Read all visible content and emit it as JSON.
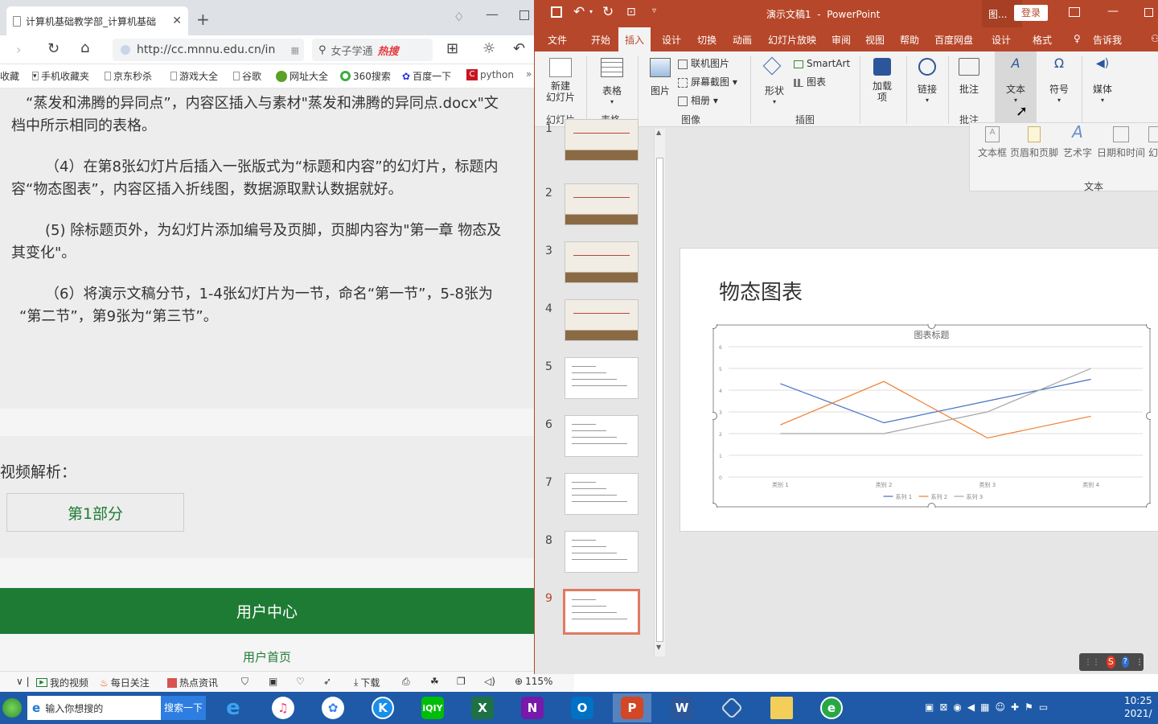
{
  "browser": {
    "tab_title": "计算机基础教学部_计算机基础",
    "url": "http://cc.mnnu.edu.cn/in",
    "search_text": "女子学通",
    "search_hot": "热搜",
    "favorites": [
      "收藏",
      "手机收藏夹",
      "京东秒杀",
      "游戏大全",
      "谷歌",
      "网址大全",
      "360搜索",
      "百度一下",
      "python"
    ],
    "paragraphs": [
      "“蒸发和沸腾的异同点”，内容区插入与素材\"蒸发和沸腾的异同点.docx\"文",
      "档中所示相同的表格。",
      "（4）在第8张幻灯片后插入一张版式为“标题和内容”的幻灯片，标题内",
      "容“物态图表”，内容区插入折线图，数据源取默认数据就好。",
      "(5) 除标题页外，为幻灯片添加编号及页脚，页脚内容为\"第一章  物态及",
      "其变化\"。",
      "（6）将演示文稿分节，1-4张幻灯片为一节，命名“第一节”，5-8张为",
      "“第二节”，第9张为“第三节”。"
    ],
    "video_label": "视频解析：",
    "part_button": "第1部分",
    "user_center": "用户中心",
    "user_home": "用户首页",
    "status_items": [
      "我的视频",
      "每日关注",
      "热点资讯",
      "下载",
      "115%"
    ]
  },
  "ppt": {
    "title": "演示文稿1  -  PowerPoint",
    "title_short": "图...",
    "login": "登录",
    "menus": [
      "文件",
      "开始",
      "插入",
      "设计",
      "切换",
      "动画",
      "幻灯片放映",
      "审阅",
      "视图",
      "帮助",
      "百度网盘",
      "设计",
      "格式",
      "告诉我"
    ],
    "ribbon": {
      "new_slide": "新建\n幻灯片",
      "table": "表格",
      "picture": "图片",
      "online_picture": "联机图片",
      "screenshot": "屏幕截图",
      "album": "相册",
      "shapes": "形状",
      "smartart": "SmartArt",
      "chart": "图表",
      "addins": "加载\n项",
      "link": "链接",
      "comment": "批注",
      "text": "文本",
      "symbol": "符号",
      "media": "媒体",
      "groups": [
        "幻灯片",
        "表格",
        "图像",
        "插图",
        "批注"
      ]
    },
    "text_dropdown": {
      "items": [
        "文本框",
        "页眉和页脚",
        "艺术字",
        "日期和时间",
        "幻灯片编号"
      ],
      "group": "文本"
    },
    "thumbnails": [
      "1",
      "2",
      "3",
      "4",
      "5",
      "6",
      "7",
      "8",
      "9"
    ],
    "slide": {
      "title": "物态图表"
    }
  },
  "chart_data": {
    "type": "line",
    "title": "图表标题",
    "categories": [
      "类别 1",
      "类别 2",
      "类别 3",
      "类别 4"
    ],
    "series": [
      {
        "name": "系列 1",
        "values": [
          4.3,
          2.5,
          3.5,
          4.5
        ],
        "color": "#4472c4"
      },
      {
        "name": "系列 2",
        "values": [
          2.4,
          4.4,
          1.8,
          2.8
        ],
        "color": "#ed7d31"
      },
      {
        "name": "系列 3",
        "values": [
          2,
          2,
          3,
          5
        ],
        "color": "#a5a5a5"
      }
    ],
    "yticks": [
      "0",
      "1",
      "2",
      "3",
      "4",
      "5",
      "6"
    ],
    "ylim": [
      0,
      6
    ],
    "grid": true,
    "legend": "bottom"
  },
  "taskbar": {
    "search_placeholder": "输入你想搜的",
    "search_button": "搜索一下",
    "time": "10:25",
    "date": "2021/"
  },
  "colors": {
    "ppt_red": "#b7472a",
    "green": "#1e7b34",
    "taskbar": "#1e5aa8"
  }
}
